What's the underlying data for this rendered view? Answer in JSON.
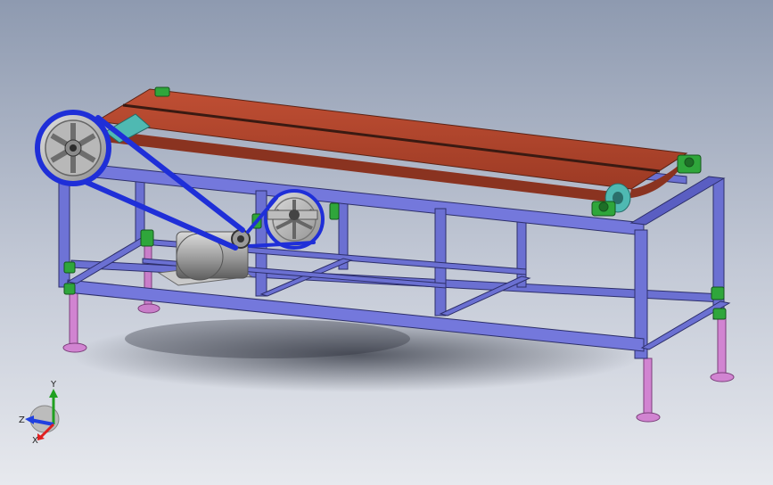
{
  "viewport": {
    "background_top": "#8e9ab0",
    "background_bottom": "#e7e9ee"
  },
  "model": {
    "frame_color": "#6a6fd0",
    "belt_color": "#b0452c",
    "drive_belt_color": "#1f2fd8",
    "leg_color": "#cf7fcf",
    "bearing_color": "#2fa63b",
    "motor_color": "#a9a9a9",
    "roller_color": "#49b8b0"
  },
  "triad": {
    "x_label": "X",
    "y_label": "Y",
    "z_label": "Z",
    "x_color": "#e02020",
    "y_color": "#20a020",
    "z_color": "#2040e0"
  }
}
